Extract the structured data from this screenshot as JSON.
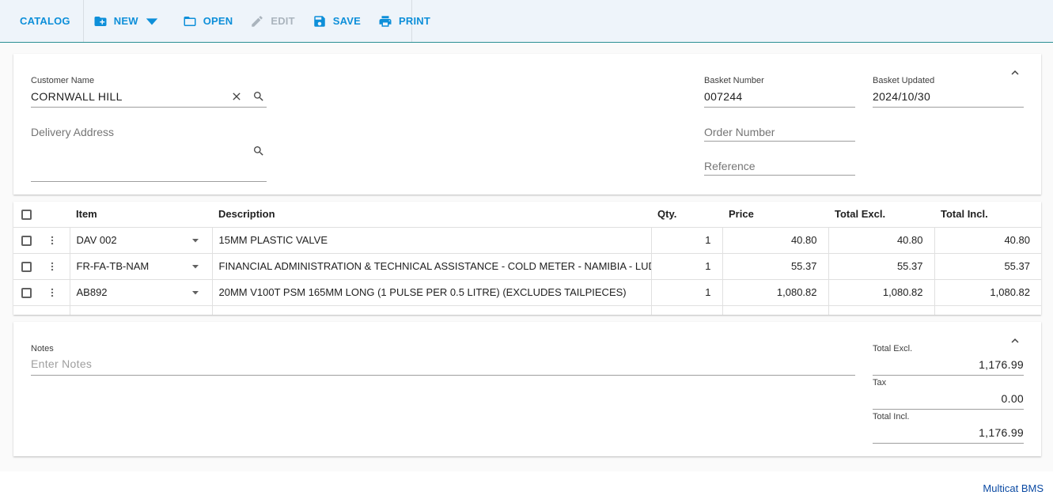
{
  "toolbar": {
    "catalog_label": "CATALOG",
    "new_label": "NEW",
    "open_label": "OPEN",
    "edit_label": "EDIT",
    "save_label": "SAVE",
    "print_label": "PRINT"
  },
  "header": {
    "customer_name_label": "Customer Name",
    "customer_name_value": "CORNWALL HILL",
    "delivery_address_label": "Delivery Address",
    "basket_number_label": "Basket Number",
    "basket_number_value": "007244",
    "basket_updated_label": "Basket Updated",
    "basket_updated_value": "2024/10/30",
    "order_number_label": "Order Number",
    "reference_label": "Reference"
  },
  "table": {
    "columns": {
      "item": "Item",
      "description": "Description",
      "qty": "Qty.",
      "price": "Price",
      "total_excl": "Total Excl.",
      "total_incl": "Total Incl."
    },
    "rows": [
      {
        "item": "DAV 002",
        "description": "15MM PLASTIC VALVE",
        "qty": "1",
        "price": "40.80",
        "total_excl": "40.80",
        "total_incl": "40.80"
      },
      {
        "item": "FR-FA-TB-NAM",
        "description": "FINANCIAL ADMINISTRATION & TECHNICAL ASSISTANCE - COLD METER - NAMIBIA - LUDWIG",
        "qty": "1",
        "price": "55.37",
        "total_excl": "55.37",
        "total_incl": "55.37"
      },
      {
        "item": "AB892",
        "description": "20MM V100T PSM 165MM LONG  (1 PULSE PER 0.5 LITRE) (EXCLUDES TAILPIECES)",
        "qty": "1",
        "price": "1,080.82",
        "total_excl": "1,080.82",
        "total_incl": "1,080.82"
      }
    ]
  },
  "summary": {
    "notes_label": "Notes",
    "notes_placeholder": "Enter Notes",
    "total_excl_label": "Total Excl.",
    "total_excl_value": "1,176.99",
    "tax_label": "Tax",
    "tax_value": "0.00",
    "total_incl_label": "Total Incl.",
    "total_incl_value": "1,176.99"
  },
  "footer": {
    "brand": "Multicat BMS"
  },
  "colors": {
    "accent": "#0d8fd9",
    "toolbar_bg": "#eef4fa",
    "toolbar_border": "#2a8f93",
    "brand": "#0b4aa3"
  }
}
